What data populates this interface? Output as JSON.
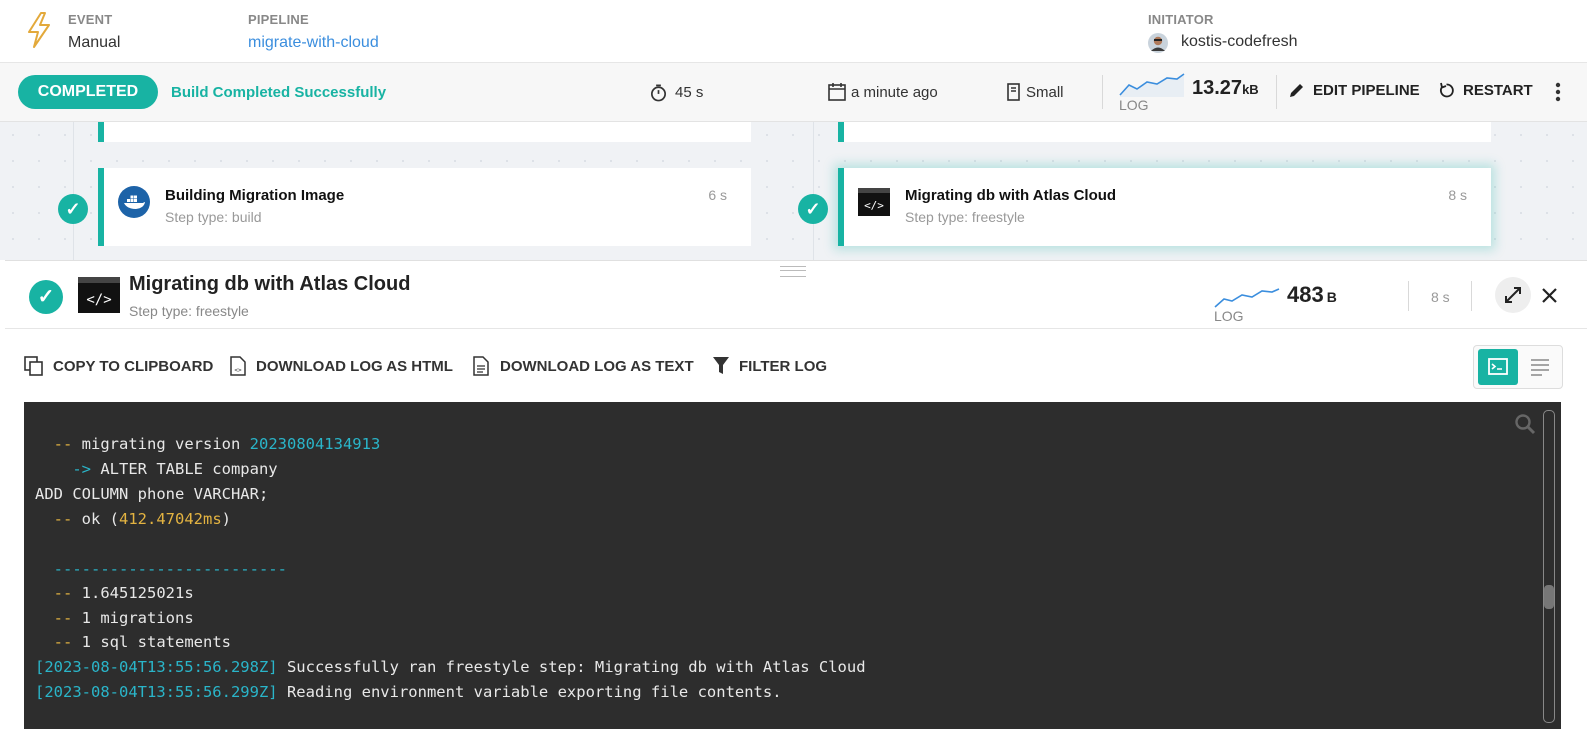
{
  "header": {
    "event_label": "EVENT",
    "event_value": "Manual",
    "pipeline_label": "PIPELINE",
    "pipeline_value": "migrate-with-cloud",
    "initiator_label": "INITIATOR",
    "initiator_value": "kostis-codefresh"
  },
  "status": {
    "badge": "COMPLETED",
    "message": "Build Completed Successfully",
    "duration": "45 s",
    "started": "a minute ago",
    "size": "Small",
    "log_label": "LOG",
    "log_size_num": "13.27",
    "log_size_unit": "kB",
    "edit_label": "EDIT PIPELINE",
    "restart_label": "RESTART"
  },
  "steps": [
    {
      "title": "Building Migration Image",
      "subtitle": "Step type: build",
      "duration": "6 s"
    },
    {
      "title": "Migrating db with Atlas Cloud",
      "subtitle": "Step type: freestyle",
      "duration": "8 s"
    }
  ],
  "drawer": {
    "title": "Migrating db with Atlas Cloud",
    "subtitle": "Step type: freestyle",
    "log_label": "LOG",
    "log_size_num": "483",
    "log_size_unit": "B",
    "duration": "8 s",
    "toolbar": {
      "copy": "COPY TO CLIPBOARD",
      "download_html": "DOWNLOAD LOG AS HTML",
      "download_text": "DOWNLOAD LOG AS TEXT",
      "filter": "FILTER LOG"
    }
  },
  "log": {
    "l1_prefix": "  -- ",
    "l1_text": "migrating version ",
    "l1_version": "20230804134913",
    "l2_prefix": "    -> ",
    "l2_text": "ALTER TABLE company",
    "l3_text": "ADD COLUMN phone VARCHAR;",
    "l4_prefix": "  -- ",
    "l4_text": "ok (",
    "l4_ms": "412.47042ms",
    "l4_close": ")",
    "l5_dashes": "  -------------------------",
    "l6_prefix": "  -- ",
    "l6_text": "1.645125021s",
    "l7_prefix": "  -- ",
    "l7_text": "1 migrations",
    "l8_prefix": "  -- ",
    "l8_text": "1 sql statements",
    "l9_ts": "[2023-08-04T13:55:56.298Z]",
    "l9_text": " Successfully ran freestyle step: Migrating db with Atlas Cloud",
    "l10_ts": "[2023-08-04T13:55:56.299Z]",
    "l10_text": " Reading environment variable exporting file contents."
  },
  "colors": {
    "accent": "#18b3a3",
    "link": "#3b8ede",
    "log_bg": "#2d2d2d"
  }
}
